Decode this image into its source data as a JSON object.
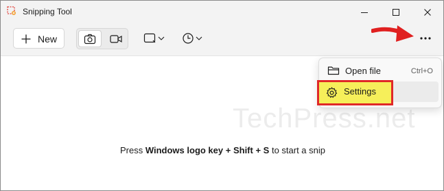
{
  "window": {
    "title": "Snipping Tool"
  },
  "toolbar": {
    "new_label": "New"
  },
  "menu": {
    "items": [
      {
        "label": "Open file",
        "shortcut": "Ctrl+O",
        "icon": "folder-icon"
      },
      {
        "label": "Settings",
        "shortcut": "",
        "icon": "gear-icon"
      }
    ]
  },
  "hint": {
    "prefix": "Press ",
    "key1": "Windows logo key",
    "sep1": " + ",
    "key2": "Shift",
    "sep2": " + ",
    "key3": "S",
    "suffix": " to start a snip"
  },
  "watermark": "TechPress.net",
  "colors": {
    "highlight_fill": "#f6ef5a",
    "highlight_border": "#e02828",
    "arrow": "#e02020",
    "accent": "#005fb8"
  }
}
